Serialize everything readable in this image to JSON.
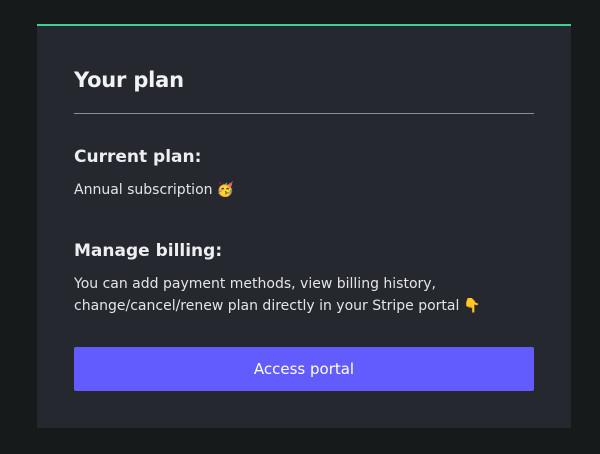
{
  "card": {
    "title": "Your plan",
    "accent_color": "#3fcf8e"
  },
  "current_plan": {
    "heading": "Current plan:",
    "value": "Annual subscription",
    "emoji": "🥳"
  },
  "manage_billing": {
    "heading": "Manage billing:",
    "description": "You can add payment methods, view billing history, change/cancel/renew plan directly in your Stripe portal",
    "emoji": "👇"
  },
  "portal_button": {
    "label": "Access portal",
    "color": "#625cff"
  }
}
